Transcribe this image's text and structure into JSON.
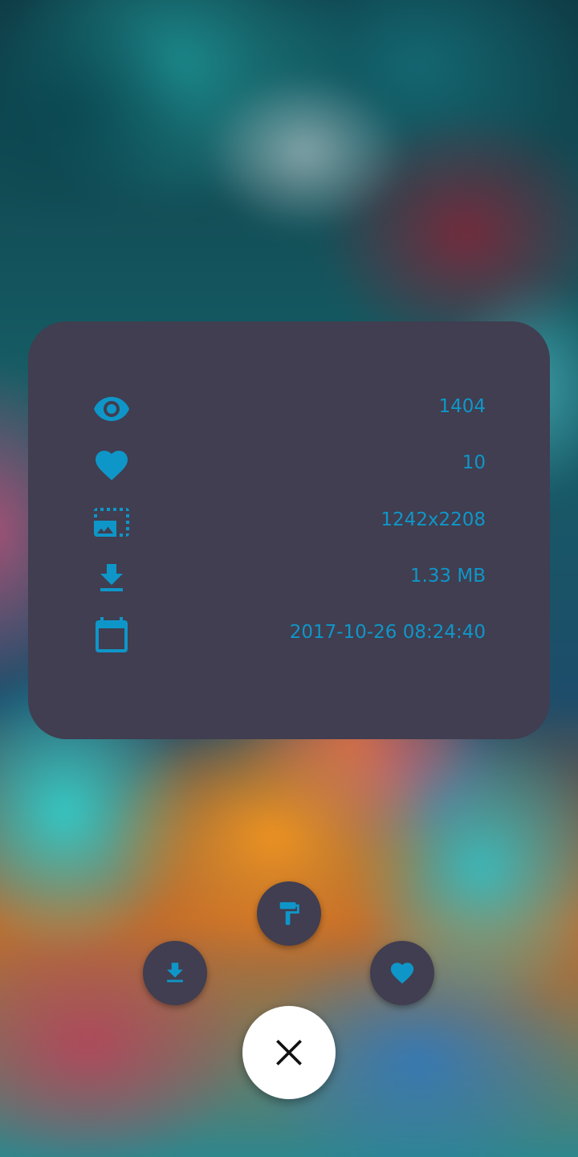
{
  "app": {
    "accent_color": "#0f96c9",
    "card_color": "#403e50",
    "close_button_color": "#ffffff"
  },
  "info": {
    "rows": [
      {
        "icon": "eye-icon",
        "label": "views",
        "value": "1404"
      },
      {
        "icon": "heart-icon",
        "label": "favorites",
        "value": "10"
      },
      {
        "icon": "resolution-icon",
        "label": "resolution",
        "value": "1242x2208"
      },
      {
        "icon": "download-icon",
        "label": "file-size",
        "value": "1.33 MB"
      },
      {
        "icon": "calendar-icon",
        "label": "upload-date",
        "value": "2017-10-26 08:24:40"
      }
    ]
  },
  "actions": {
    "items": [
      {
        "name": "set-wallpaper-button",
        "icon": "paint-roller-icon"
      },
      {
        "name": "download-button",
        "icon": "download-icon"
      },
      {
        "name": "favorite-button",
        "icon": "heart-icon"
      },
      {
        "name": "close-button",
        "icon": "close-icon"
      }
    ]
  }
}
